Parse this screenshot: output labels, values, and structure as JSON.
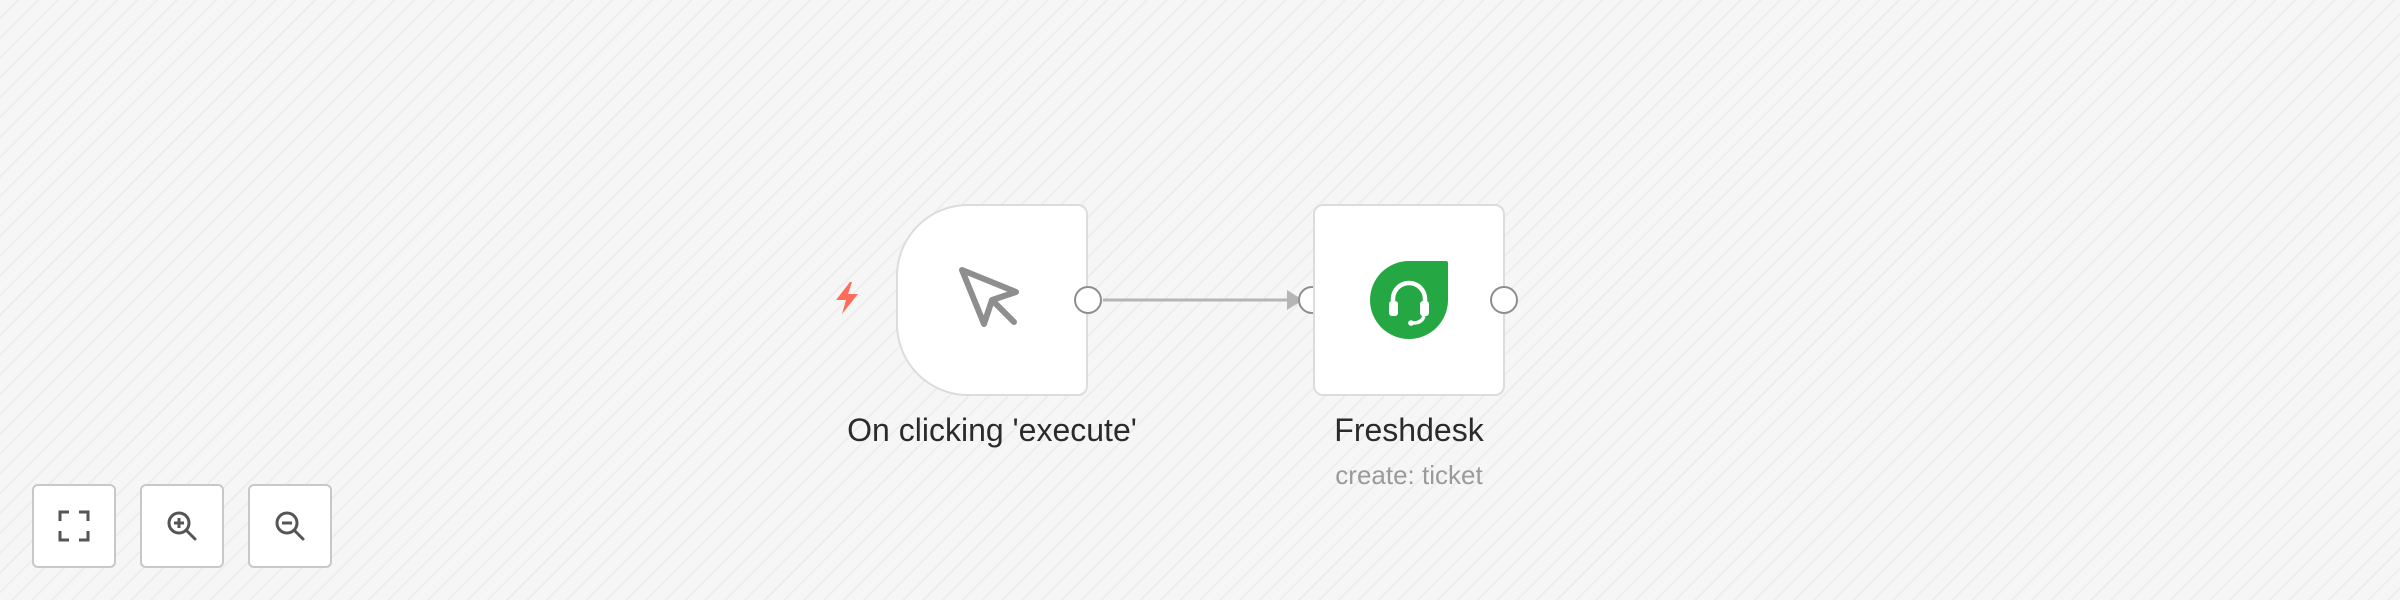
{
  "workflow": {
    "nodes": [
      {
        "id": "trigger",
        "label": "On clicking 'execute'",
        "subtitle": "",
        "icon": "mouse-pointer-icon",
        "trigger_icon": "lightning-bolt-icon"
      },
      {
        "id": "freshdesk",
        "label": "Freshdesk",
        "subtitle": "create: ticket",
        "icon": "freshdesk-headset-icon"
      }
    ],
    "connections": [
      {
        "from": "trigger",
        "to": "freshdesk"
      }
    ]
  },
  "controls": {
    "buttons": [
      {
        "name": "fit-view",
        "icon": "fullscreen-icon"
      },
      {
        "name": "zoom-in",
        "icon": "zoom-in-icon"
      },
      {
        "name": "zoom-out",
        "icon": "zoom-out-icon"
      }
    ]
  },
  "colors": {
    "canvas_background": "#f6f6f6",
    "node_border": "#dcdcdc",
    "trigger_bolt": "#ff6d5a",
    "freshdesk_brand": "#25a843",
    "connector": "#b5b5b5",
    "icon_gray": "#8e8e8e"
  }
}
